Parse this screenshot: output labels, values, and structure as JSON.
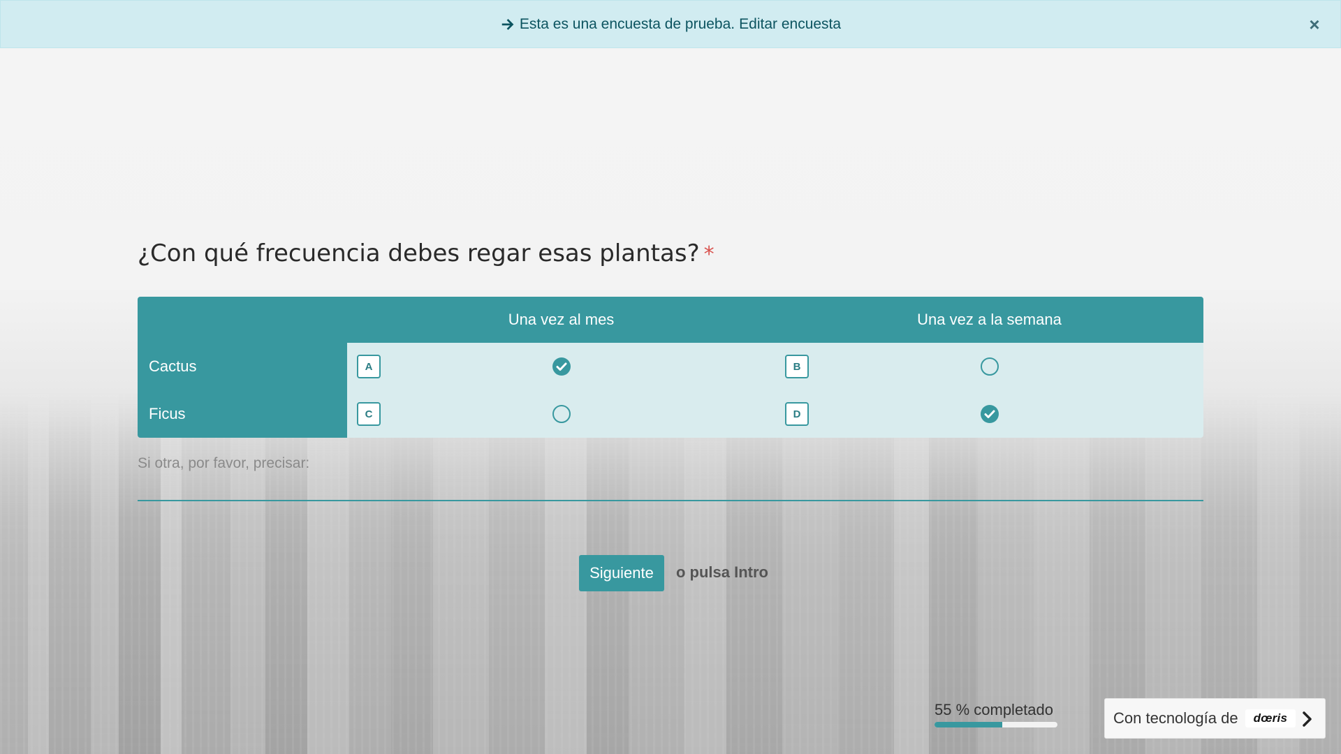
{
  "banner": {
    "message": "Esta es una encuesta de prueba.",
    "link_label": "Editar encuesta",
    "icon": "arrow-right-icon",
    "close_label": "×"
  },
  "question": {
    "text": "¿Con qué frecuencia debes regar esas plantas?",
    "required_mark": "*"
  },
  "matrix": {
    "columns": [
      "Una vez al mes",
      "Una vez a la semana"
    ],
    "rows": [
      {
        "label": "Cactus",
        "cells": [
          {
            "key": "A",
            "selected": true
          },
          {
            "key": "B",
            "selected": false
          }
        ]
      },
      {
        "label": "Ficus",
        "cells": [
          {
            "key": "C",
            "selected": false
          },
          {
            "key": "D",
            "selected": true
          }
        ]
      }
    ]
  },
  "other": {
    "label": "Si otra, por favor, precisar:",
    "value": ""
  },
  "navigation": {
    "next_label": "Siguiente",
    "hint": "o pulsa Intro"
  },
  "progress": {
    "label": "55 % completado",
    "percent": 55
  },
  "footer": {
    "powered_label": "Con tecnología de",
    "brand": "dœris",
    "icon": "chevron-right-icon"
  },
  "colors": {
    "accent": "#38989f",
    "cell_bg": "#d9ecee",
    "banner_bg": "#d1ecf1",
    "required": "#d9534f"
  }
}
